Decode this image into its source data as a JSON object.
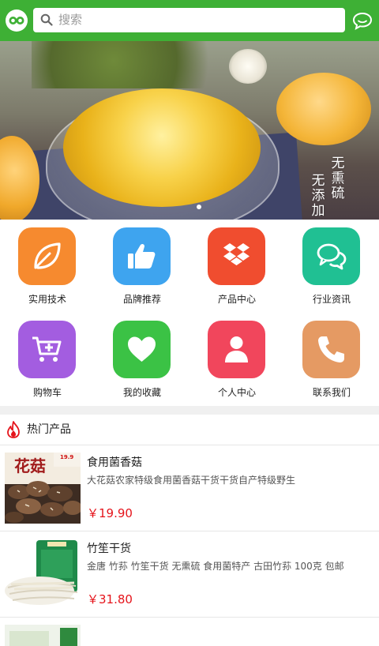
{
  "header": {
    "search_placeholder": "搜索",
    "icons": {
      "logo": "app-logo-icon",
      "search": "search-icon",
      "message": "chat-bubble-icon"
    },
    "color": "#3eb035"
  },
  "banner": {
    "overlay_text_1": "无熏硫",
    "overlay_text_2": "无添加",
    "slide_count": 1,
    "active_slide": 1
  },
  "menu": [
    {
      "label": "实用技术",
      "icon": "leaf-icon",
      "color": "#f68a2f"
    },
    {
      "label": "品牌推荐",
      "icon": "thumbs-up-icon",
      "color": "#3ea4ef"
    },
    {
      "label": "产品中心",
      "icon": "dropbox-icon",
      "color": "#f04d2f"
    },
    {
      "label": "行业资讯",
      "icon": "chat-icon",
      "color": "#20c093"
    },
    {
      "label": "购物车",
      "icon": "cart-icon",
      "color": "#a35de0"
    },
    {
      "label": "我的收藏",
      "icon": "heart-icon",
      "color": "#3bc245"
    },
    {
      "label": "个人中心",
      "icon": "user-icon",
      "color": "#f1465c"
    },
    {
      "label": "联系我们",
      "icon": "phone-icon",
      "color": "#e59a63"
    }
  ],
  "hot": {
    "title": "热门产品",
    "icon": "flame-icon"
  },
  "products": [
    {
      "name": "食用菌香菇",
      "desc": "大花菇农家特级食用菌香菇干货干货自产特级野生",
      "price": "￥19.90",
      "thumb_text": "花菇",
      "thumb_badge": "19.9"
    },
    {
      "name": "竹笙干货",
      "desc": "金唐 竹荪 竹笙干货 无熏硫 食用菌特产 古田竹荪 100克 包邮",
      "price": "￥31.80"
    }
  ]
}
